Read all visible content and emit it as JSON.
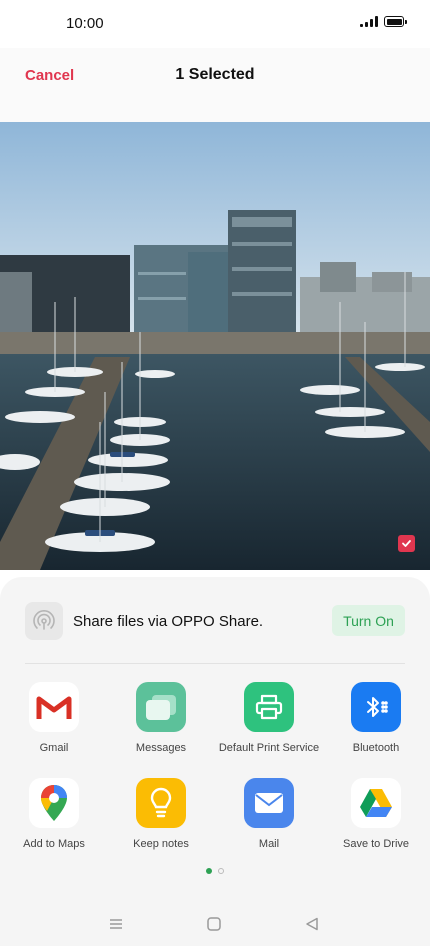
{
  "status_bar": {
    "time": "10:00"
  },
  "header": {
    "cancel_label": "Cancel",
    "title": "1 Selected"
  },
  "photo": {
    "selected": true,
    "accent_color": "#e0364f"
  },
  "oppo_share": {
    "label": "Share files via OPPO Share.",
    "button_label": "Turn On",
    "accent_color": "#2da154"
  },
  "apps": [
    {
      "label": "Gmail",
      "icon": "gmail-icon"
    },
    {
      "label": "Messages",
      "icon": "messages-icon"
    },
    {
      "label": "Default Print Service",
      "icon": "print-icon"
    },
    {
      "label": "Bluetooth",
      "icon": "bluetooth-icon"
    },
    {
      "label": "Add to Maps",
      "icon": "maps-icon"
    },
    {
      "label": "Keep notes",
      "icon": "keep-icon"
    },
    {
      "label": "Mail",
      "icon": "mail-icon"
    },
    {
      "label": "Save to Drive",
      "icon": "drive-icon"
    }
  ],
  "pager": {
    "pages": 2,
    "current": 1
  },
  "nav_bar": {
    "buttons": [
      "menu",
      "home",
      "back"
    ]
  }
}
